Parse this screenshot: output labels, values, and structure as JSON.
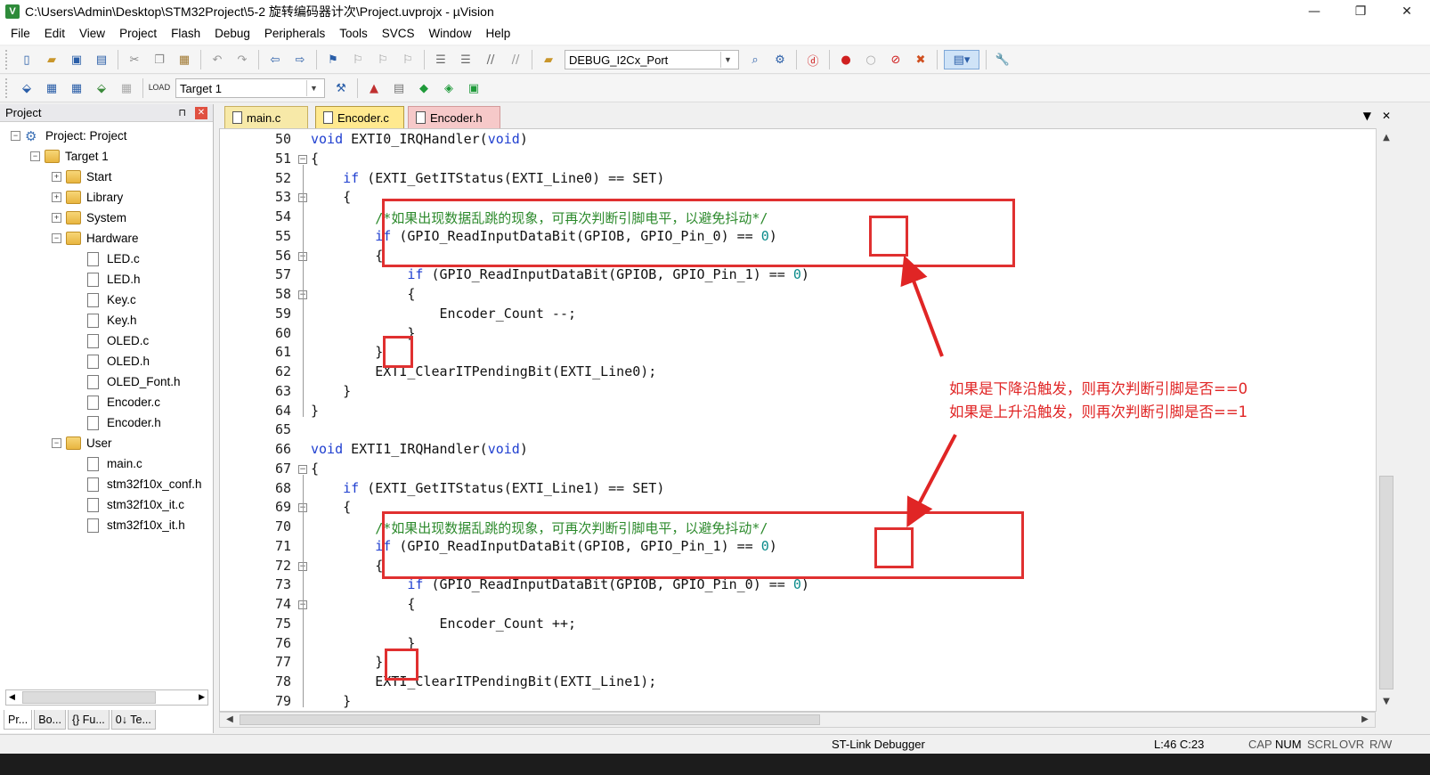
{
  "window": {
    "title": "C:\\Users\\Admin\\Desktop\\STM32Project\\5-2 旋转编码器计次\\Project.uvprojx - µVision",
    "app_icon": "V",
    "minimize": "—",
    "maximize": "❐",
    "close": "✕"
  },
  "menu": [
    "File",
    "Edit",
    "View",
    "Project",
    "Flash",
    "Debug",
    "Peripherals",
    "Tools",
    "SVCS",
    "Window",
    "Help"
  ],
  "toolbar": {
    "find_combo": "DEBUG_I2Cx_Port",
    "target_combo": "Target 1"
  },
  "project_panel": {
    "title": "Project",
    "pin": "⊓",
    "close": "✕",
    "root": "Project: Project",
    "target": "Target 1",
    "groups": {
      "start": "Start",
      "library": "Library",
      "system": "System",
      "hardware": "Hardware",
      "user": "User"
    },
    "hardware_files": [
      "LED.c",
      "LED.h",
      "Key.c",
      "Key.h",
      "OLED.c",
      "OLED.h",
      "OLED_Font.h",
      "Encoder.c",
      "Encoder.h"
    ],
    "user_files": [
      "main.c",
      "stm32f10x_conf.h",
      "stm32f10x_it.c",
      "stm32f10x_it.h"
    ],
    "tabs": [
      "Pr...",
      "Bo...",
      "{} Fu...",
      "0↓ Te..."
    ]
  },
  "editor": {
    "tabs": [
      "main.c",
      "Encoder.c",
      "Encoder.h"
    ],
    "active_tab": "Encoder.c",
    "lines": [
      {
        "n": "50",
        "segs": [
          [
            "kw",
            "void"
          ],
          [
            "t",
            " EXTI0_IRQHandler("
          ],
          [
            "kw",
            "void"
          ],
          [
            "t",
            ")"
          ]
        ]
      },
      {
        "n": "51",
        "segs": [
          [
            "t",
            "{"
          ]
        ]
      },
      {
        "n": "52",
        "segs": [
          [
            "t",
            "    "
          ],
          [
            "kw",
            "if"
          ],
          [
            "t",
            " (EXTI_GetITStatus(EXTI_Line0) == SET)"
          ]
        ]
      },
      {
        "n": "53",
        "segs": [
          [
            "t",
            "    {"
          ]
        ]
      },
      {
        "n": "54",
        "segs": [
          [
            "t",
            "        "
          ],
          [
            "cmt",
            "/*如果出现数据乱跳的现象，可再次判断引脚电平，以避免抖动*/"
          ]
        ]
      },
      {
        "n": "55",
        "segs": [
          [
            "t",
            "        "
          ],
          [
            "kw",
            "if"
          ],
          [
            "t",
            " (GPIO_ReadInputDataBit(GPIOB, GPIO_Pin_0) == "
          ],
          [
            "num",
            "0"
          ],
          [
            "t",
            ")"
          ]
        ]
      },
      {
        "n": "56",
        "segs": [
          [
            "t",
            "        {"
          ]
        ]
      },
      {
        "n": "57",
        "segs": [
          [
            "t",
            "            "
          ],
          [
            "kw",
            "if"
          ],
          [
            "t",
            " (GPIO_ReadInputDataBit(GPIOB, GPIO_Pin_1) == "
          ],
          [
            "num",
            "0"
          ],
          [
            "t",
            ")"
          ]
        ]
      },
      {
        "n": "58",
        "segs": [
          [
            "t",
            "            {"
          ]
        ]
      },
      {
        "n": "59",
        "segs": [
          [
            "t",
            "                Encoder_Count --;"
          ]
        ]
      },
      {
        "n": "60",
        "segs": [
          [
            "t",
            "            }"
          ]
        ]
      },
      {
        "n": "61",
        "segs": [
          [
            "t",
            "        }"
          ]
        ]
      },
      {
        "n": "62",
        "segs": [
          [
            "t",
            "        EXTI_ClearITPendingBit(EXTI_Line0);"
          ]
        ]
      },
      {
        "n": "63",
        "segs": [
          [
            "t",
            "    }"
          ]
        ]
      },
      {
        "n": "64",
        "segs": [
          [
            "t",
            "}"
          ]
        ]
      },
      {
        "n": "65",
        "segs": [
          [
            "t",
            ""
          ]
        ]
      },
      {
        "n": "66",
        "segs": [
          [
            "kw",
            "void"
          ],
          [
            "t",
            " EXTI1_IRQHandler("
          ],
          [
            "kw",
            "void"
          ],
          [
            "t",
            ")"
          ]
        ]
      },
      {
        "n": "67",
        "segs": [
          [
            "t",
            "{"
          ]
        ]
      },
      {
        "n": "68",
        "segs": [
          [
            "t",
            "    "
          ],
          [
            "kw",
            "if"
          ],
          [
            "t",
            " (EXTI_GetITStatus(EXTI_Line1) == SET)"
          ]
        ]
      },
      {
        "n": "69",
        "segs": [
          [
            "t",
            "    {"
          ]
        ]
      },
      {
        "n": "70",
        "segs": [
          [
            "t",
            "        "
          ],
          [
            "cmt",
            "/*如果出现数据乱跳的现象，可再次判断引脚电平，以避免抖动*/"
          ]
        ]
      },
      {
        "n": "71",
        "segs": [
          [
            "t",
            "        "
          ],
          [
            "kw",
            "if"
          ],
          [
            "t",
            " (GPIO_ReadInputDataBit(GPIOB, GPIO_Pin_1) == "
          ],
          [
            "num",
            "0"
          ],
          [
            "t",
            ")"
          ]
        ]
      },
      {
        "n": "72",
        "segs": [
          [
            "t",
            "        {"
          ]
        ]
      },
      {
        "n": "73",
        "segs": [
          [
            "t",
            "            "
          ],
          [
            "kw",
            "if"
          ],
          [
            "t",
            " (GPIO_ReadInputDataBit(GPIOB, GPIO_Pin_0) == "
          ],
          [
            "num",
            "0"
          ],
          [
            "t",
            ")"
          ]
        ]
      },
      {
        "n": "74",
        "segs": [
          [
            "t",
            "            {"
          ]
        ]
      },
      {
        "n": "75",
        "segs": [
          [
            "t",
            "                Encoder_Count ++;"
          ]
        ]
      },
      {
        "n": "76",
        "segs": [
          [
            "t",
            "            }"
          ]
        ]
      },
      {
        "n": "77",
        "segs": [
          [
            "t",
            "        }"
          ]
        ]
      },
      {
        "n": "78",
        "segs": [
          [
            "t",
            "        EXTI_ClearITPendingBit(EXTI_Line1);"
          ]
        ]
      },
      {
        "n": "79",
        "segs": [
          [
            "t",
            "    }"
          ]
        ]
      }
    ],
    "folds": [
      "51",
      "53",
      "56",
      "58",
      "67",
      "69",
      "72",
      "74"
    ]
  },
  "annotation": {
    "line1": "如果是下降沿触发，则再次判断引脚是否==0",
    "line2": "如果是上升沿触发，则再次判断引脚是否==1",
    "color": "#e02525"
  },
  "status": {
    "debugger": "ST-Link Debugger",
    "position": "L:46 C:23",
    "cap": "CAP",
    "num": "NUM",
    "scrl": "SCRL",
    "ovr": "OVR",
    "rw": "R/W"
  }
}
